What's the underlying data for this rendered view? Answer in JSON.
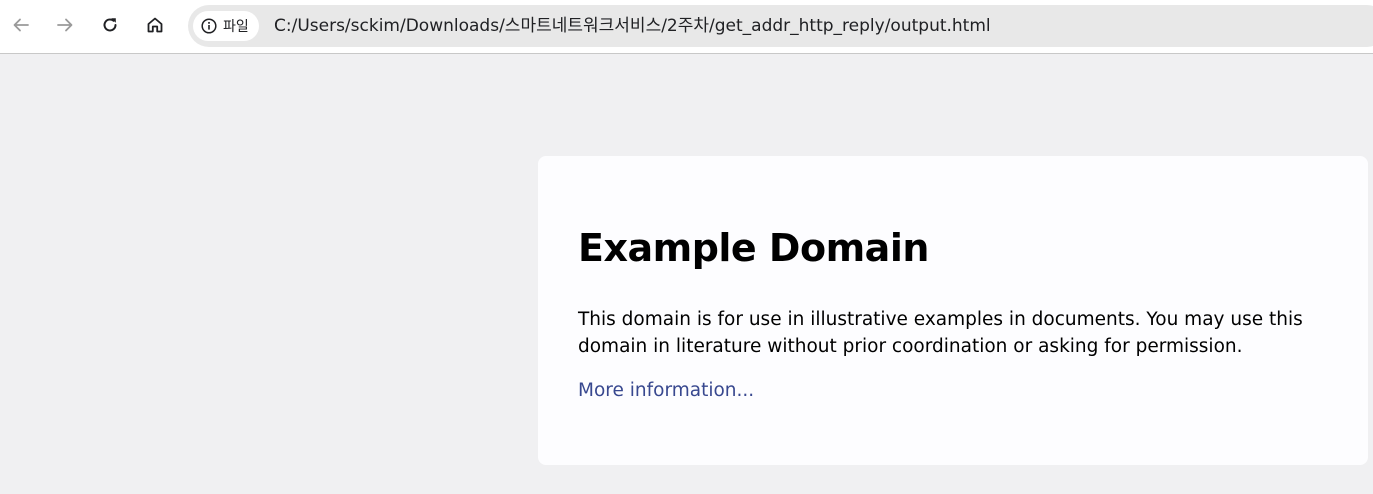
{
  "browser": {
    "back_icon": "arrow-left-icon",
    "forward_icon": "arrow-right-icon",
    "reload_icon": "reload-icon",
    "home_icon": "home-icon",
    "site_info_icon": "info-circle-icon",
    "site_info_label": "파일",
    "url": "C:/Users/sckim/Downloads/스마트네트워크서비스/2주차/get_addr_http_reply/output.html"
  },
  "page": {
    "title": "Example Domain",
    "description": "This domain is for use in illustrative examples in documents. You may use this domain in literature without prior coordination or asking for permission.",
    "link_text": "More information..."
  },
  "colors": {
    "page_background": "#f0f0f2",
    "card_background": "#fdfdff",
    "link": "#38488f",
    "omnibox": "#e8e8e8"
  }
}
